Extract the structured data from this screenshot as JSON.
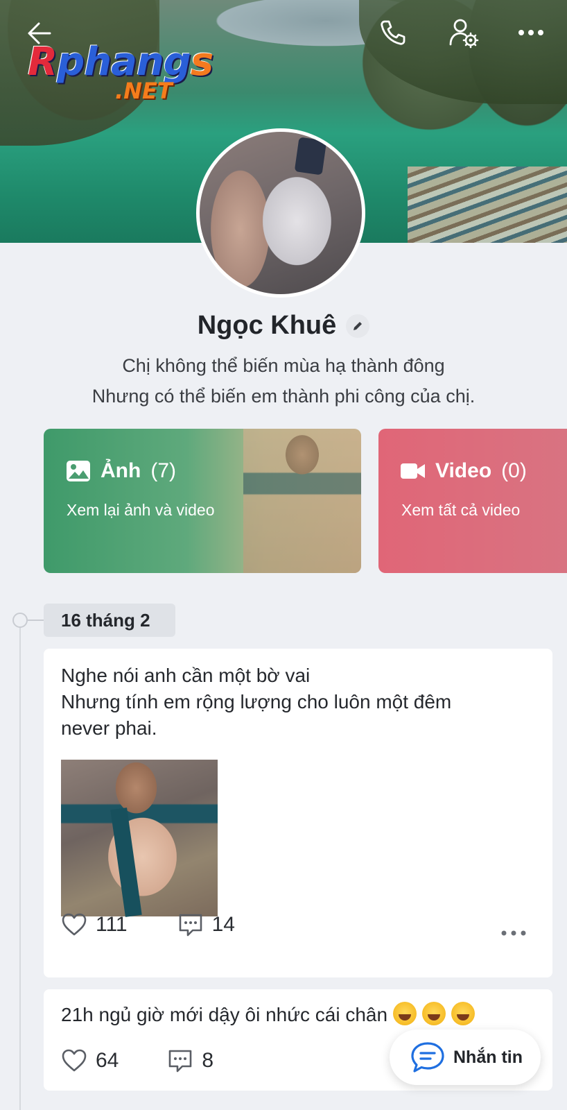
{
  "header": {
    "watermark_main": "Rphangs",
    "watermark_sub": ".NET"
  },
  "profile": {
    "name": "Ngọc Khuê",
    "bio_line1": "Chị không thể biến mùa hạ thành đông",
    "bio_line2": "Nhưng có thể biến em thành phi công của chị."
  },
  "cards": {
    "photo": {
      "title": "Ảnh",
      "count": "(7)",
      "subtitle": "Xem lại ảnh và video"
    },
    "video": {
      "title": "Video",
      "count": "(0)",
      "subtitle": "Xem tất cả video"
    }
  },
  "timeline": {
    "date": "16 tháng 2"
  },
  "posts": [
    {
      "line1": "Nghe nói anh cần một bờ vai",
      "line2": "Nhưng tính em rộng lượng cho luôn một đêm",
      "line3": "never phai.",
      "likes": "111",
      "comments": "14"
    },
    {
      "text": "21h ngủ giờ mới dậy ôi nhức cái chân",
      "likes": "64",
      "comments": "8"
    }
  ],
  "message_button": {
    "label": "Nhắn tin"
  },
  "icons": {
    "back": "back-arrow-icon",
    "call": "phone-icon",
    "profile_settings": "user-gear-icon",
    "more": "more-dots-icon",
    "edit": "pencil-icon",
    "photo": "image-icon",
    "video": "video-camera-icon",
    "like": "heart-icon",
    "comment": "comment-icon",
    "message": "chat-bubble-icon",
    "emoji": "laughing-tears-emoji"
  },
  "colors": {
    "photo_card": "#3f9a6a",
    "video_card": "#e06677",
    "message_icon": "#1f6fe0"
  }
}
